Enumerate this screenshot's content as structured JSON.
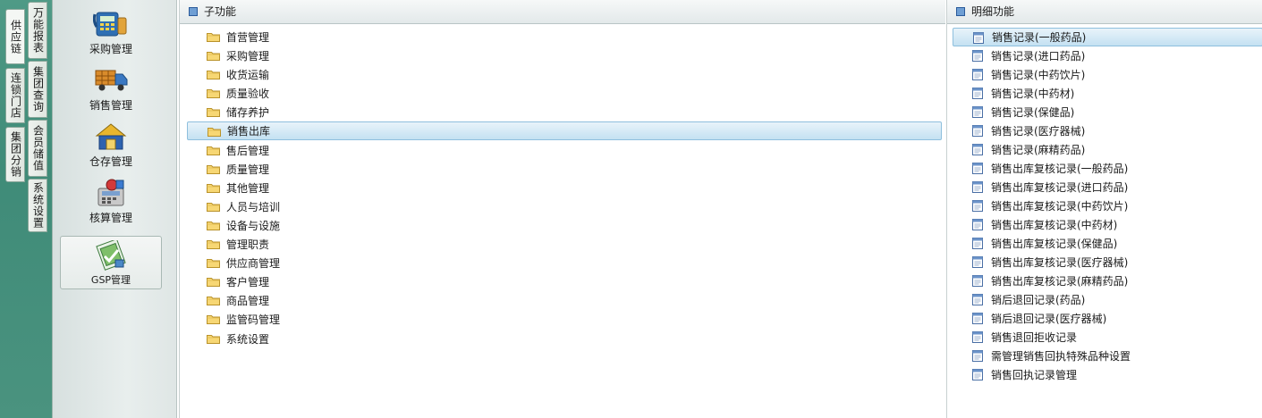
{
  "side_tabs": {
    "left": [
      "供应链",
      "连锁门店",
      "集团分销"
    ],
    "right": [
      "万能报表",
      "集团查询",
      "会员储值",
      "系统设置"
    ]
  },
  "modules": [
    {
      "label": "采购管理",
      "icon": "phone-calculator-icon"
    },
    {
      "label": "销售管理",
      "icon": "delivery-truck-icon"
    },
    {
      "label": "仓存管理",
      "icon": "warehouse-icon"
    },
    {
      "label": "核算管理",
      "icon": "accounting-icon"
    },
    {
      "label": "GSP管理",
      "icon": "gsp-certificate-icon",
      "selected": true
    }
  ],
  "sub_panel": {
    "title": "子功能",
    "items": [
      "首营管理",
      "采购管理",
      "收货运输",
      "质量验收",
      "储存养护",
      "销售出库",
      "售后管理",
      "质量管理",
      "其他管理",
      "人员与培训",
      "设备与设施",
      "管理职责",
      "供应商管理",
      "客户管理",
      "商品管理",
      "监管码管理",
      "系统设置"
    ],
    "selected_index": 5
  },
  "detail_panel": {
    "title": "明细功能",
    "items": [
      "销售记录(一般药品)",
      "销售记录(进口药品)",
      "销售记录(中药饮片)",
      "销售记录(中药材)",
      "销售记录(保健品)",
      "销售记录(医疗器械)",
      "销售记录(麻精药品)",
      "销售出库复核记录(一般药品)",
      "销售出库复核记录(进口药品)",
      "销售出库复核记录(中药饮片)",
      "销售出库复核记录(中药材)",
      "销售出库复核记录(保健品)",
      "销售出库复核记录(医疗器械)",
      "销售出库复核记录(麻精药品)",
      "销后退回记录(药品)",
      "销后退回记录(医疗器械)",
      "销售退回拒收记录",
      "需管理销售回执特殊品种设置",
      "销售回执记录管理"
    ],
    "selected_index": 0
  },
  "colors": {
    "accent_green": "#4a937f",
    "selection": "#c4e1f2",
    "folder": "#f2c94c"
  }
}
